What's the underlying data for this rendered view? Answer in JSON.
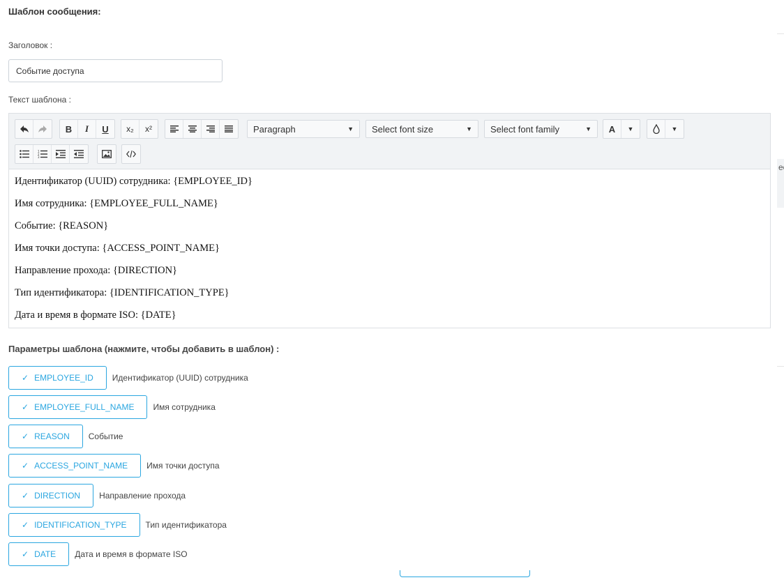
{
  "header": {
    "section_title": "Шаблон сообщения:"
  },
  "form": {
    "title_label": "Заголовок :",
    "title_value": "Событие доступа",
    "body_label": "Текст шаблона :"
  },
  "toolbar": {
    "paragraph_select": "Paragraph",
    "font_size_select": "Select font size",
    "font_family_select": "Select font family",
    "text_color_letter": "A",
    "subscript_label": "x₂",
    "superscript_label": "x²",
    "bold_label": "B",
    "italic_label": "I",
    "underline_label": "U"
  },
  "editor": {
    "lines": [
      "Идентификатор (UUID) сотрудника: {EMPLOYEE_ID}",
      "Имя сотрудника: {EMPLOYEE_FULL_NAME}",
      "Событие: {REASON}",
      "Имя точки доступа: {ACCESS_POINT_NAME}",
      "Направление прохода: {DIRECTION}",
      "Тип идентификатора: {IDENTIFICATION_TYPE}",
      "Дата и время в формате ISO: {DATE}"
    ]
  },
  "params": {
    "title": "Параметры шаблона (нажмите, чтобы добавить в шаблон) :",
    "items": [
      {
        "label": "EMPLOYEE_ID",
        "description": "Идентификатор (UUID) сотрудника"
      },
      {
        "label": "EMPLOYEE_FULL_NAME",
        "description": "Имя сотрудника"
      },
      {
        "label": "REASON",
        "description": "Событие"
      },
      {
        "label": "ACCESS_POINT_NAME",
        "description": "Имя точки доступа"
      },
      {
        "label": "DIRECTION",
        "description": "Направление прохода"
      },
      {
        "label": "IDENTIFICATION_TYPE",
        "description": "Тип идентификатора"
      },
      {
        "label": "DATE",
        "description": "Дата и время в формате ISO"
      }
    ]
  },
  "edge": {
    "cut_text": "ec"
  },
  "colors": {
    "accent": "#2aa6e0",
    "toolbar_bg": "#f1f3f5",
    "border": "#dcdfe3"
  }
}
